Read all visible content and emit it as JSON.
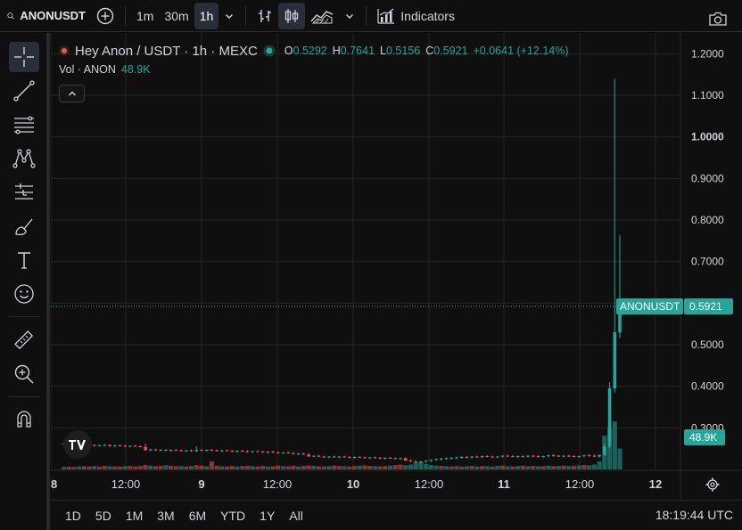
{
  "toolbar": {
    "symbol": "ANONUSDT",
    "intervals": [
      "1m",
      "30m",
      "1h"
    ],
    "active_interval": "1h",
    "indicators_label": "Indicators"
  },
  "legend": {
    "title": "Hey Anon / USDT · 1h · MEXC",
    "open_label": "O",
    "open": "0.5292",
    "high_label": "H",
    "high": "0.7641",
    "low_label": "L",
    "low": "0.5156",
    "close_label": "C",
    "close": "0.5921",
    "change": "+0.0641 (+12.14%)",
    "volume_label": "Vol · ANON",
    "volume": "48.9K"
  },
  "colors": {
    "up": "#26a69a",
    "down": "#ef5350",
    "background": "#0f0f0f",
    "grid": "#262626"
  },
  "price_axis": {
    "ticks": [
      "1.2000",
      "1.1000",
      "1.0000",
      "0.9000",
      "0.8000",
      "0.7000",
      "0.6000",
      "0.5000",
      "0.4000",
      "0.3000"
    ],
    "last_label": "ANONUSDT",
    "last_price": "0.5921",
    "volume_badge": "48.9K"
  },
  "time_axis": {
    "labels": [
      "8",
      "12:00",
      "9",
      "12:00",
      "10",
      "12:00",
      "11",
      "12:00",
      "12"
    ]
  },
  "bottombar": {
    "ranges": [
      "1D",
      "5D",
      "1M",
      "3M",
      "6M",
      "YTD",
      "1Y",
      "All"
    ],
    "clock": "18:19:44 UTC"
  },
  "chart_data": {
    "type": "candlestick",
    "price_range": [
      0.2,
      1.25
    ],
    "last_price": 0.5921,
    "candles": [
      {
        "o": 0.262,
        "h": 0.264,
        "l": 0.259,
        "c": 0.261
      },
      {
        "o": 0.261,
        "h": 0.263,
        "l": 0.258,
        "c": 0.26
      },
      {
        "o": 0.26,
        "h": 0.262,
        "l": 0.257,
        "c": 0.259
      },
      {
        "o": 0.259,
        "h": 0.261,
        "l": 0.256,
        "c": 0.258
      },
      {
        "o": 0.258,
        "h": 0.262,
        "l": 0.257,
        "c": 0.26
      },
      {
        "o": 0.26,
        "h": 0.262,
        "l": 0.257,
        "c": 0.259
      },
      {
        "o": 0.259,
        "h": 0.26,
        "l": 0.255,
        "c": 0.257
      },
      {
        "o": 0.257,
        "h": 0.26,
        "l": 0.256,
        "c": 0.258
      },
      {
        "o": 0.258,
        "h": 0.261,
        "l": 0.256,
        "c": 0.259
      },
      {
        "o": 0.259,
        "h": 0.26,
        "l": 0.255,
        "c": 0.256
      },
      {
        "o": 0.256,
        "h": 0.259,
        "l": 0.254,
        "c": 0.258
      },
      {
        "o": 0.258,
        "h": 0.26,
        "l": 0.256,
        "c": 0.257
      },
      {
        "o": 0.257,
        "h": 0.259,
        "l": 0.254,
        "c": 0.255
      },
      {
        "o": 0.255,
        "h": 0.258,
        "l": 0.253,
        "c": 0.257
      },
      {
        "o": 0.257,
        "h": 0.259,
        "l": 0.255,
        "c": 0.256
      },
      {
        "o": 0.256,
        "h": 0.258,
        "l": 0.253,
        "c": 0.254
      },
      {
        "o": 0.254,
        "h": 0.262,
        "l": 0.252,
        "c": 0.246
      },
      {
        "o": 0.246,
        "h": 0.25,
        "l": 0.244,
        "c": 0.248
      },
      {
        "o": 0.248,
        "h": 0.25,
        "l": 0.245,
        "c": 0.246
      },
      {
        "o": 0.246,
        "h": 0.249,
        "l": 0.244,
        "c": 0.247
      },
      {
        "o": 0.247,
        "h": 0.249,
        "l": 0.244,
        "c": 0.245
      },
      {
        "o": 0.245,
        "h": 0.248,
        "l": 0.243,
        "c": 0.247
      },
      {
        "o": 0.247,
        "h": 0.249,
        "l": 0.245,
        "c": 0.246
      },
      {
        "o": 0.246,
        "h": 0.248,
        "l": 0.243,
        "c": 0.244
      },
      {
        "o": 0.244,
        "h": 0.247,
        "l": 0.242,
        "c": 0.246
      },
      {
        "o": 0.246,
        "h": 0.248,
        "l": 0.243,
        "c": 0.244
      },
      {
        "o": 0.244,
        "h": 0.256,
        "l": 0.242,
        "c": 0.247
      },
      {
        "o": 0.247,
        "h": 0.249,
        "l": 0.244,
        "c": 0.245
      },
      {
        "o": 0.245,
        "h": 0.248,
        "l": 0.243,
        "c": 0.247
      },
      {
        "o": 0.247,
        "h": 0.249,
        "l": 0.245,
        "c": 0.246
      },
      {
        "o": 0.246,
        "h": 0.248,
        "l": 0.243,
        "c": 0.244
      },
      {
        "o": 0.244,
        "h": 0.247,
        "l": 0.242,
        "c": 0.246
      },
      {
        "o": 0.246,
        "h": 0.248,
        "l": 0.244,
        "c": 0.245
      },
      {
        "o": 0.245,
        "h": 0.247,
        "l": 0.242,
        "c": 0.243
      },
      {
        "o": 0.243,
        "h": 0.246,
        "l": 0.241,
        "c": 0.245
      },
      {
        "o": 0.245,
        "h": 0.247,
        "l": 0.243,
        "c": 0.244
      },
      {
        "o": 0.244,
        "h": 0.246,
        "l": 0.241,
        "c": 0.242
      },
      {
        "o": 0.242,
        "h": 0.245,
        "l": 0.24,
        "c": 0.244
      },
      {
        "o": 0.244,
        "h": 0.246,
        "l": 0.242,
        "c": 0.243
      },
      {
        "o": 0.243,
        "h": 0.245,
        "l": 0.24,
        "c": 0.241
      },
      {
        "o": 0.241,
        "h": 0.244,
        "l": 0.239,
        "c": 0.243
      },
      {
        "o": 0.243,
        "h": 0.245,
        "l": 0.24,
        "c": 0.241
      },
      {
        "o": 0.241,
        "h": 0.243,
        "l": 0.238,
        "c": 0.239
      },
      {
        "o": 0.239,
        "h": 0.242,
        "l": 0.237,
        "c": 0.241
      },
      {
        "o": 0.241,
        "h": 0.243,
        "l": 0.238,
        "c": 0.239
      },
      {
        "o": 0.239,
        "h": 0.242,
        "l": 0.236,
        "c": 0.237
      },
      {
        "o": 0.237,
        "h": 0.24,
        "l": 0.235,
        "c": 0.238
      },
      {
        "o": 0.238,
        "h": 0.24,
        "l": 0.235,
        "c": 0.236
      },
      {
        "o": 0.236,
        "h": 0.239,
        "l": 0.234,
        "c": 0.231
      },
      {
        "o": 0.231,
        "h": 0.234,
        "l": 0.229,
        "c": 0.233
      },
      {
        "o": 0.233,
        "h": 0.235,
        "l": 0.23,
        "c": 0.231
      },
      {
        "o": 0.231,
        "h": 0.233,
        "l": 0.228,
        "c": 0.229
      },
      {
        "o": 0.229,
        "h": 0.232,
        "l": 0.227,
        "c": 0.231
      },
      {
        "o": 0.231,
        "h": 0.233,
        "l": 0.228,
        "c": 0.229
      },
      {
        "o": 0.229,
        "h": 0.232,
        "l": 0.227,
        "c": 0.231
      },
      {
        "o": 0.231,
        "h": 0.233,
        "l": 0.229,
        "c": 0.23
      },
      {
        "o": 0.23,
        "h": 0.232,
        "l": 0.227,
        "c": 0.228
      },
      {
        "o": 0.228,
        "h": 0.231,
        "l": 0.226,
        "c": 0.23
      },
      {
        "o": 0.23,
        "h": 0.232,
        "l": 0.228,
        "c": 0.229
      },
      {
        "o": 0.229,
        "h": 0.231,
        "l": 0.226,
        "c": 0.227
      },
      {
        "o": 0.227,
        "h": 0.23,
        "l": 0.225,
        "c": 0.229
      },
      {
        "o": 0.229,
        "h": 0.231,
        "l": 0.227,
        "c": 0.228
      },
      {
        "o": 0.228,
        "h": 0.23,
        "l": 0.225,
        "c": 0.226
      },
      {
        "o": 0.226,
        "h": 0.229,
        "l": 0.224,
        "c": 0.228
      },
      {
        "o": 0.228,
        "h": 0.23,
        "l": 0.226,
        "c": 0.227
      },
      {
        "o": 0.227,
        "h": 0.229,
        "l": 0.224,
        "c": 0.225
      },
      {
        "o": 0.225,
        "h": 0.228,
        "l": 0.223,
        "c": 0.227
      },
      {
        "o": 0.227,
        "h": 0.229,
        "l": 0.224,
        "c": 0.221
      },
      {
        "o": 0.221,
        "h": 0.224,
        "l": 0.218,
        "c": 0.219
      },
      {
        "o": 0.219,
        "h": 0.222,
        "l": 0.216,
        "c": 0.217
      },
      {
        "o": 0.217,
        "h": 0.221,
        "l": 0.215,
        "c": 0.219
      },
      {
        "o": 0.219,
        "h": 0.222,
        "l": 0.216,
        "c": 0.221
      },
      {
        "o": 0.221,
        "h": 0.224,
        "l": 0.218,
        "c": 0.223
      },
      {
        "o": 0.223,
        "h": 0.226,
        "l": 0.22,
        "c": 0.225
      },
      {
        "o": 0.225,
        "h": 0.228,
        "l": 0.222,
        "c": 0.226
      },
      {
        "o": 0.226,
        "h": 0.229,
        "l": 0.223,
        "c": 0.227
      },
      {
        "o": 0.227,
        "h": 0.23,
        "l": 0.224,
        "c": 0.228
      },
      {
        "o": 0.228,
        "h": 0.231,
        "l": 0.225,
        "c": 0.229
      },
      {
        "o": 0.229,
        "h": 0.232,
        "l": 0.226,
        "c": 0.23
      },
      {
        "o": 0.23,
        "h": 0.232,
        "l": 0.227,
        "c": 0.229
      },
      {
        "o": 0.229,
        "h": 0.232,
        "l": 0.226,
        "c": 0.231
      },
      {
        "o": 0.231,
        "h": 0.233,
        "l": 0.228,
        "c": 0.23
      },
      {
        "o": 0.23,
        "h": 0.233,
        "l": 0.227,
        "c": 0.232
      },
      {
        "o": 0.232,
        "h": 0.234,
        "l": 0.229,
        "c": 0.231
      },
      {
        "o": 0.231,
        "h": 0.233,
        "l": 0.228,
        "c": 0.229
      },
      {
        "o": 0.229,
        "h": 0.232,
        "l": 0.227,
        "c": 0.231
      },
      {
        "o": 0.231,
        "h": 0.234,
        "l": 0.228,
        "c": 0.233
      },
      {
        "o": 0.233,
        "h": 0.235,
        "l": 0.23,
        "c": 0.232
      },
      {
        "o": 0.232,
        "h": 0.234,
        "l": 0.229,
        "c": 0.23
      },
      {
        "o": 0.23,
        "h": 0.233,
        "l": 0.228,
        "c": 0.232
      },
      {
        "o": 0.232,
        "h": 0.234,
        "l": 0.229,
        "c": 0.231
      },
      {
        "o": 0.231,
        "h": 0.234,
        "l": 0.228,
        "c": 0.233
      },
      {
        "o": 0.233,
        "h": 0.235,
        "l": 0.23,
        "c": 0.232
      },
      {
        "o": 0.232,
        "h": 0.234,
        "l": 0.229,
        "c": 0.23
      },
      {
        "o": 0.23,
        "h": 0.233,
        "l": 0.228,
        "c": 0.232
      },
      {
        "o": 0.232,
        "h": 0.235,
        "l": 0.229,
        "c": 0.234
      },
      {
        "o": 0.234,
        "h": 0.236,
        "l": 0.231,
        "c": 0.233
      },
      {
        "o": 0.233,
        "h": 0.235,
        "l": 0.23,
        "c": 0.231
      },
      {
        "o": 0.231,
        "h": 0.234,
        "l": 0.229,
        "c": 0.233
      },
      {
        "o": 0.233,
        "h": 0.235,
        "l": 0.23,
        "c": 0.232
      },
      {
        "o": 0.232,
        "h": 0.234,
        "l": 0.229,
        "c": 0.23
      },
      {
        "o": 0.23,
        "h": 0.233,
        "l": 0.228,
        "c": 0.232
      },
      {
        "o": 0.232,
        "h": 0.235,
        "l": 0.229,
        "c": 0.234
      },
      {
        "o": 0.234,
        "h": 0.237,
        "l": 0.231,
        "c": 0.233
      },
      {
        "o": 0.233,
        "h": 0.236,
        "l": 0.23,
        "c": 0.231
      },
      {
        "o": 0.231,
        "h": 0.234,
        "l": 0.228,
        "c": 0.235
      },
      {
        "o": 0.235,
        "h": 0.262,
        "l": 0.233,
        "c": 0.255
      },
      {
        "o": 0.255,
        "h": 0.41,
        "l": 0.25,
        "c": 0.395
      },
      {
        "o": 0.395,
        "h": 1.14,
        "l": 0.385,
        "c": 0.53
      },
      {
        "o": 0.5292,
        "h": 0.7641,
        "l": 0.5156,
        "c": 0.5921
      }
    ],
    "volumes": [
      {
        "v": 0.3,
        "d": "up"
      },
      {
        "v": 0.35,
        "d": "down"
      },
      {
        "v": 0.32,
        "d": "down"
      },
      {
        "v": 0.36,
        "d": "up"
      },
      {
        "v": 0.4,
        "d": "down"
      },
      {
        "v": 0.38,
        "d": "down"
      },
      {
        "v": 0.42,
        "d": "up"
      },
      {
        "v": 0.37,
        "d": "down"
      },
      {
        "v": 0.45,
        "d": "down"
      },
      {
        "v": 0.4,
        "d": "up"
      },
      {
        "v": 0.38,
        "d": "down"
      },
      {
        "v": 0.35,
        "d": "down"
      },
      {
        "v": 0.4,
        "d": "up"
      },
      {
        "v": 0.44,
        "d": "down"
      },
      {
        "v": 0.38,
        "d": "down"
      },
      {
        "v": 0.42,
        "d": "down"
      },
      {
        "v": 0.55,
        "d": "down"
      },
      {
        "v": 0.48,
        "d": "up"
      },
      {
        "v": 0.4,
        "d": "down"
      },
      {
        "v": 0.44,
        "d": "down"
      },
      {
        "v": 0.52,
        "d": "up"
      },
      {
        "v": 0.46,
        "d": "down"
      },
      {
        "v": 0.4,
        "d": "down"
      },
      {
        "v": 0.42,
        "d": "up"
      },
      {
        "v": 0.38,
        "d": "down"
      },
      {
        "v": 0.44,
        "d": "up"
      },
      {
        "v": 0.55,
        "d": "down"
      },
      {
        "v": 0.48,
        "d": "down"
      },
      {
        "v": 0.4,
        "d": "up"
      },
      {
        "v": 1.0,
        "d": "down"
      },
      {
        "v": 0.46,
        "d": "down"
      },
      {
        "v": 0.4,
        "d": "up"
      },
      {
        "v": 0.38,
        "d": "down"
      },
      {
        "v": 0.44,
        "d": "down"
      },
      {
        "v": 0.36,
        "d": "up"
      },
      {
        "v": 0.42,
        "d": "down"
      },
      {
        "v": 0.46,
        "d": "down"
      },
      {
        "v": 0.4,
        "d": "up"
      },
      {
        "v": 0.38,
        "d": "down"
      },
      {
        "v": 0.44,
        "d": "down"
      },
      {
        "v": 0.36,
        "d": "up"
      },
      {
        "v": 0.4,
        "d": "down"
      },
      {
        "v": 0.48,
        "d": "down"
      },
      {
        "v": 0.42,
        "d": "up"
      },
      {
        "v": 0.4,
        "d": "down"
      },
      {
        "v": 0.46,
        "d": "down"
      },
      {
        "v": 0.38,
        "d": "up"
      },
      {
        "v": 0.44,
        "d": "down"
      },
      {
        "v": 0.5,
        "d": "down"
      },
      {
        "v": 0.46,
        "d": "up"
      },
      {
        "v": 0.4,
        "d": "down"
      },
      {
        "v": 0.38,
        "d": "down"
      },
      {
        "v": 0.42,
        "d": "up"
      },
      {
        "v": 0.48,
        "d": "down"
      },
      {
        "v": 0.44,
        "d": "down"
      },
      {
        "v": 0.4,
        "d": "up"
      },
      {
        "v": 0.36,
        "d": "down"
      },
      {
        "v": 0.42,
        "d": "down"
      },
      {
        "v": 0.46,
        "d": "up"
      },
      {
        "v": 0.5,
        "d": "down"
      },
      {
        "v": 0.44,
        "d": "down"
      },
      {
        "v": 0.4,
        "d": "up"
      },
      {
        "v": 0.38,
        "d": "down"
      },
      {
        "v": 0.42,
        "d": "down"
      },
      {
        "v": 0.48,
        "d": "up"
      },
      {
        "v": 0.55,
        "d": "down"
      },
      {
        "v": 0.6,
        "d": "down"
      },
      {
        "v": 0.52,
        "d": "up"
      },
      {
        "v": 0.6,
        "d": "up"
      },
      {
        "v": 0.85,
        "d": "up"
      },
      {
        "v": 0.95,
        "d": "up"
      },
      {
        "v": 0.7,
        "d": "up"
      },
      {
        "v": 0.55,
        "d": "up"
      },
      {
        "v": 0.48,
        "d": "up"
      },
      {
        "v": 0.44,
        "d": "down"
      },
      {
        "v": 0.4,
        "d": "up"
      },
      {
        "v": 0.38,
        "d": "down"
      },
      {
        "v": 0.42,
        "d": "up"
      },
      {
        "v": 0.36,
        "d": "down"
      },
      {
        "v": 0.4,
        "d": "up"
      },
      {
        "v": 0.44,
        "d": "down"
      },
      {
        "v": 0.38,
        "d": "up"
      },
      {
        "v": 0.42,
        "d": "down"
      },
      {
        "v": 0.4,
        "d": "up"
      },
      {
        "v": 0.36,
        "d": "down"
      },
      {
        "v": 0.44,
        "d": "up"
      },
      {
        "v": 0.48,
        "d": "down"
      },
      {
        "v": 0.4,
        "d": "up"
      },
      {
        "v": 0.38,
        "d": "down"
      },
      {
        "v": 0.42,
        "d": "up"
      },
      {
        "v": 0.46,
        "d": "down"
      },
      {
        "v": 0.4,
        "d": "up"
      },
      {
        "v": 0.44,
        "d": "down"
      },
      {
        "v": 0.38,
        "d": "up"
      },
      {
        "v": 0.42,
        "d": "down"
      },
      {
        "v": 0.46,
        "d": "up"
      },
      {
        "v": 0.4,
        "d": "down"
      },
      {
        "v": 0.44,
        "d": "up"
      },
      {
        "v": 0.48,
        "d": "down"
      },
      {
        "v": 0.42,
        "d": "up"
      },
      {
        "v": 0.46,
        "d": "down"
      },
      {
        "v": 0.5,
        "d": "up"
      },
      {
        "v": 0.55,
        "d": "down"
      },
      {
        "v": 0.52,
        "d": "up"
      },
      {
        "v": 0.6,
        "d": "up"
      },
      {
        "v": 1.0,
        "d": "up"
      },
      {
        "v": 4.2,
        "d": "up"
      },
      {
        "v": 5.2,
        "d": "up"
      },
      {
        "v": 6.0,
        "d": "up"
      },
      {
        "v": 2.6,
        "d": "up"
      }
    ]
  }
}
